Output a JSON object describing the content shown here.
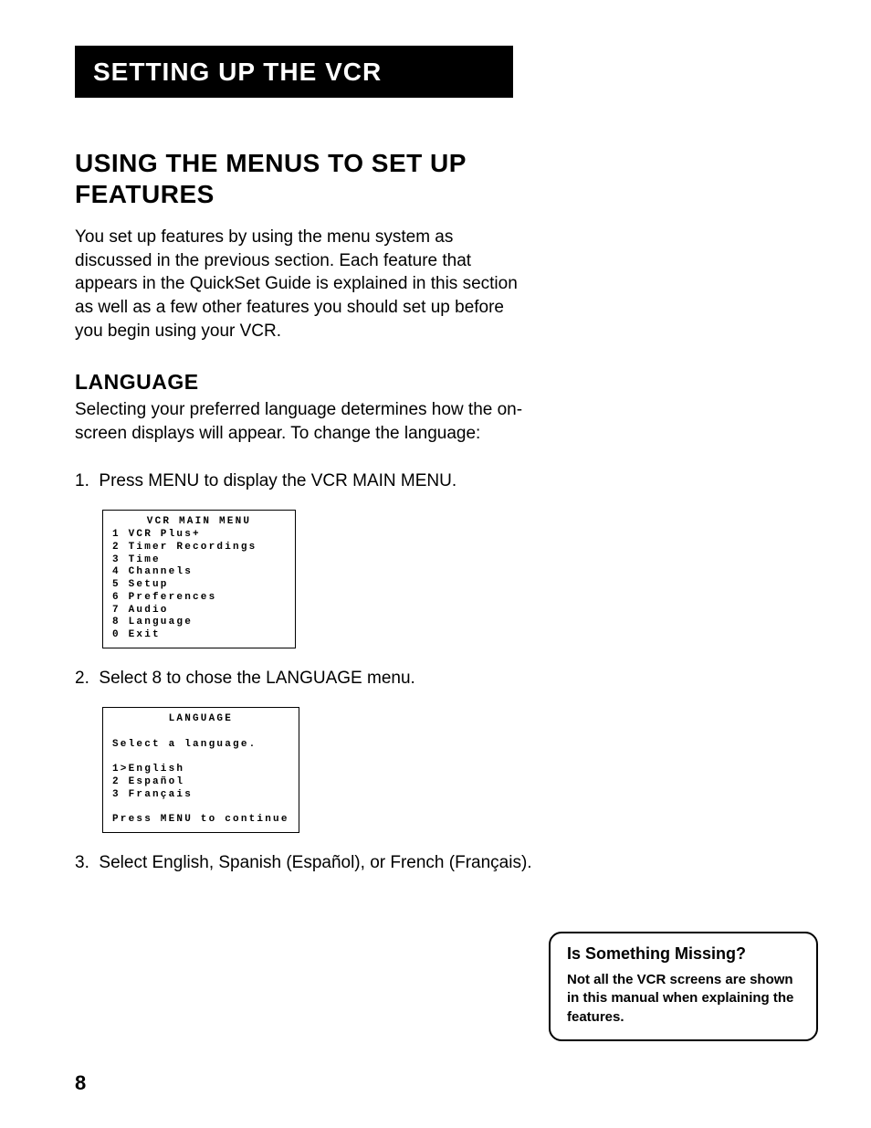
{
  "chapter_title": "Setting Up the VCR",
  "section_title": "Using the Menus to Set Up Features",
  "intro_paragraph": "You set up features by using the menu system as discussed in the previous section. Each feature that appears in the QuickSet Guide is explained in this section as well as a few other features you should set up before you begin using your VCR.",
  "subsection_title": "Language",
  "subsection_intro": "Selecting your preferred language determines how the on-screen displays will appear. To change the language:",
  "steps": {
    "s1_num": "1.",
    "s1_text": "Press MENU to display the VCR MAIN MENU.",
    "s2_num": "2.",
    "s2_text": "Select 8 to chose the LANGUAGE menu.",
    "s3_num": "3.",
    "s3_text": "Select English, Spanish (Español), or French (Français)."
  },
  "screen1": {
    "title": "VCR MAIN MENU",
    "lines": "1 VCR Plus+\n2 Timer Recordings\n3 Time\n4 Channels\n5 Setup\n6 Preferences\n7 Audio\n8 Language\n0 Exit"
  },
  "screen2": {
    "title": "LANGUAGE",
    "prompt": "Select a language.",
    "options": "1>English\n2 Español\n3 Français",
    "footer": "Press MENU to continue"
  },
  "callout": {
    "title": "Is Something Missing?",
    "body": "Not all the VCR screens are shown in this manual when explaining the features."
  },
  "page_number": "8"
}
